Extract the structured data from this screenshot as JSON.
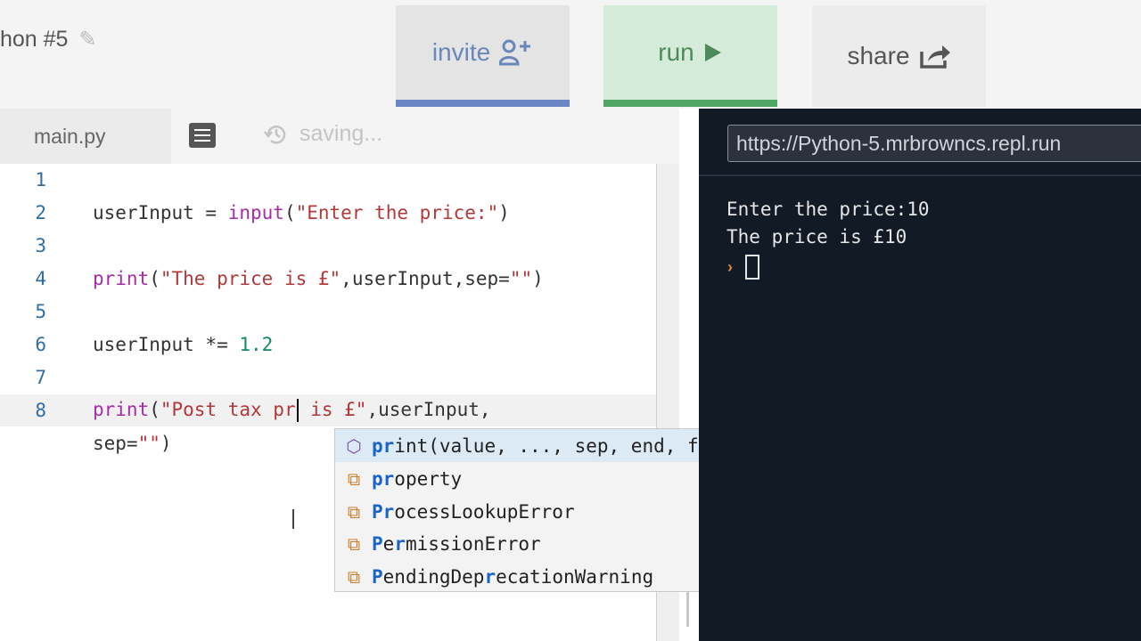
{
  "header": {
    "project_title": "hon #5",
    "invite_label": "invite",
    "run_label": "run",
    "share_label": "share"
  },
  "editor": {
    "tab_label": "main.py",
    "saving_label": "saving...",
    "lines": [
      {
        "no": "1"
      },
      {
        "no": "2",
        "parts": [
          "userInput = ",
          "input",
          "(",
          "\"Enter the price:\"",
          ")"
        ]
      },
      {
        "no": "3"
      },
      {
        "no": "4",
        "parts": [
          "print",
          "(",
          "\"The price is £\"",
          ",userInput,sep=",
          "\"\"",
          ")"
        ]
      },
      {
        "no": "5"
      },
      {
        "no": "6",
        "parts": [
          "userInput *= ",
          "1.2"
        ]
      },
      {
        "no": "7"
      },
      {
        "no": "8",
        "parts": [
          "print",
          "(",
          "\"Post tax pr",
          " is £\"",
          ",userInput,"
        ]
      },
      {
        "no": "",
        "parts": [
          "sep=",
          "\"\"",
          ")"
        ]
      }
    ]
  },
  "autocomplete": {
    "items": [
      {
        "match": "pr",
        "rest": "int(value, ..., sep, end, file, flush)",
        "kind": "method",
        "icon": "method-cube-icon"
      },
      {
        "match": "pr",
        "rest": "operty",
        "kind": "class",
        "icon": "class-icon"
      },
      {
        "match": "Pr",
        "rest": "ocessLookupError",
        "kind": "class",
        "icon": "class-icon"
      },
      {
        "match_a": "P",
        "mid": "e",
        "match_b": "r",
        "rest": "missionError",
        "kind": "class",
        "icon": "class-icon"
      },
      {
        "match_a": "P",
        "mid": "endingDep",
        "match_b": "r",
        "rest": "ecationWarning",
        "kind": "class",
        "icon": "class-icon"
      }
    ]
  },
  "console": {
    "url": "https://Python-5.mrbrowncs.repl.run",
    "output": [
      "Enter the price:10",
      "The price is £10"
    ]
  },
  "colors": {
    "keyword": "#a52da6",
    "string": "#b4373a",
    "number": "#16886b",
    "console_bg": "#121a26",
    "run_accent": "#4fa564",
    "invite_accent": "#6b86c4"
  }
}
